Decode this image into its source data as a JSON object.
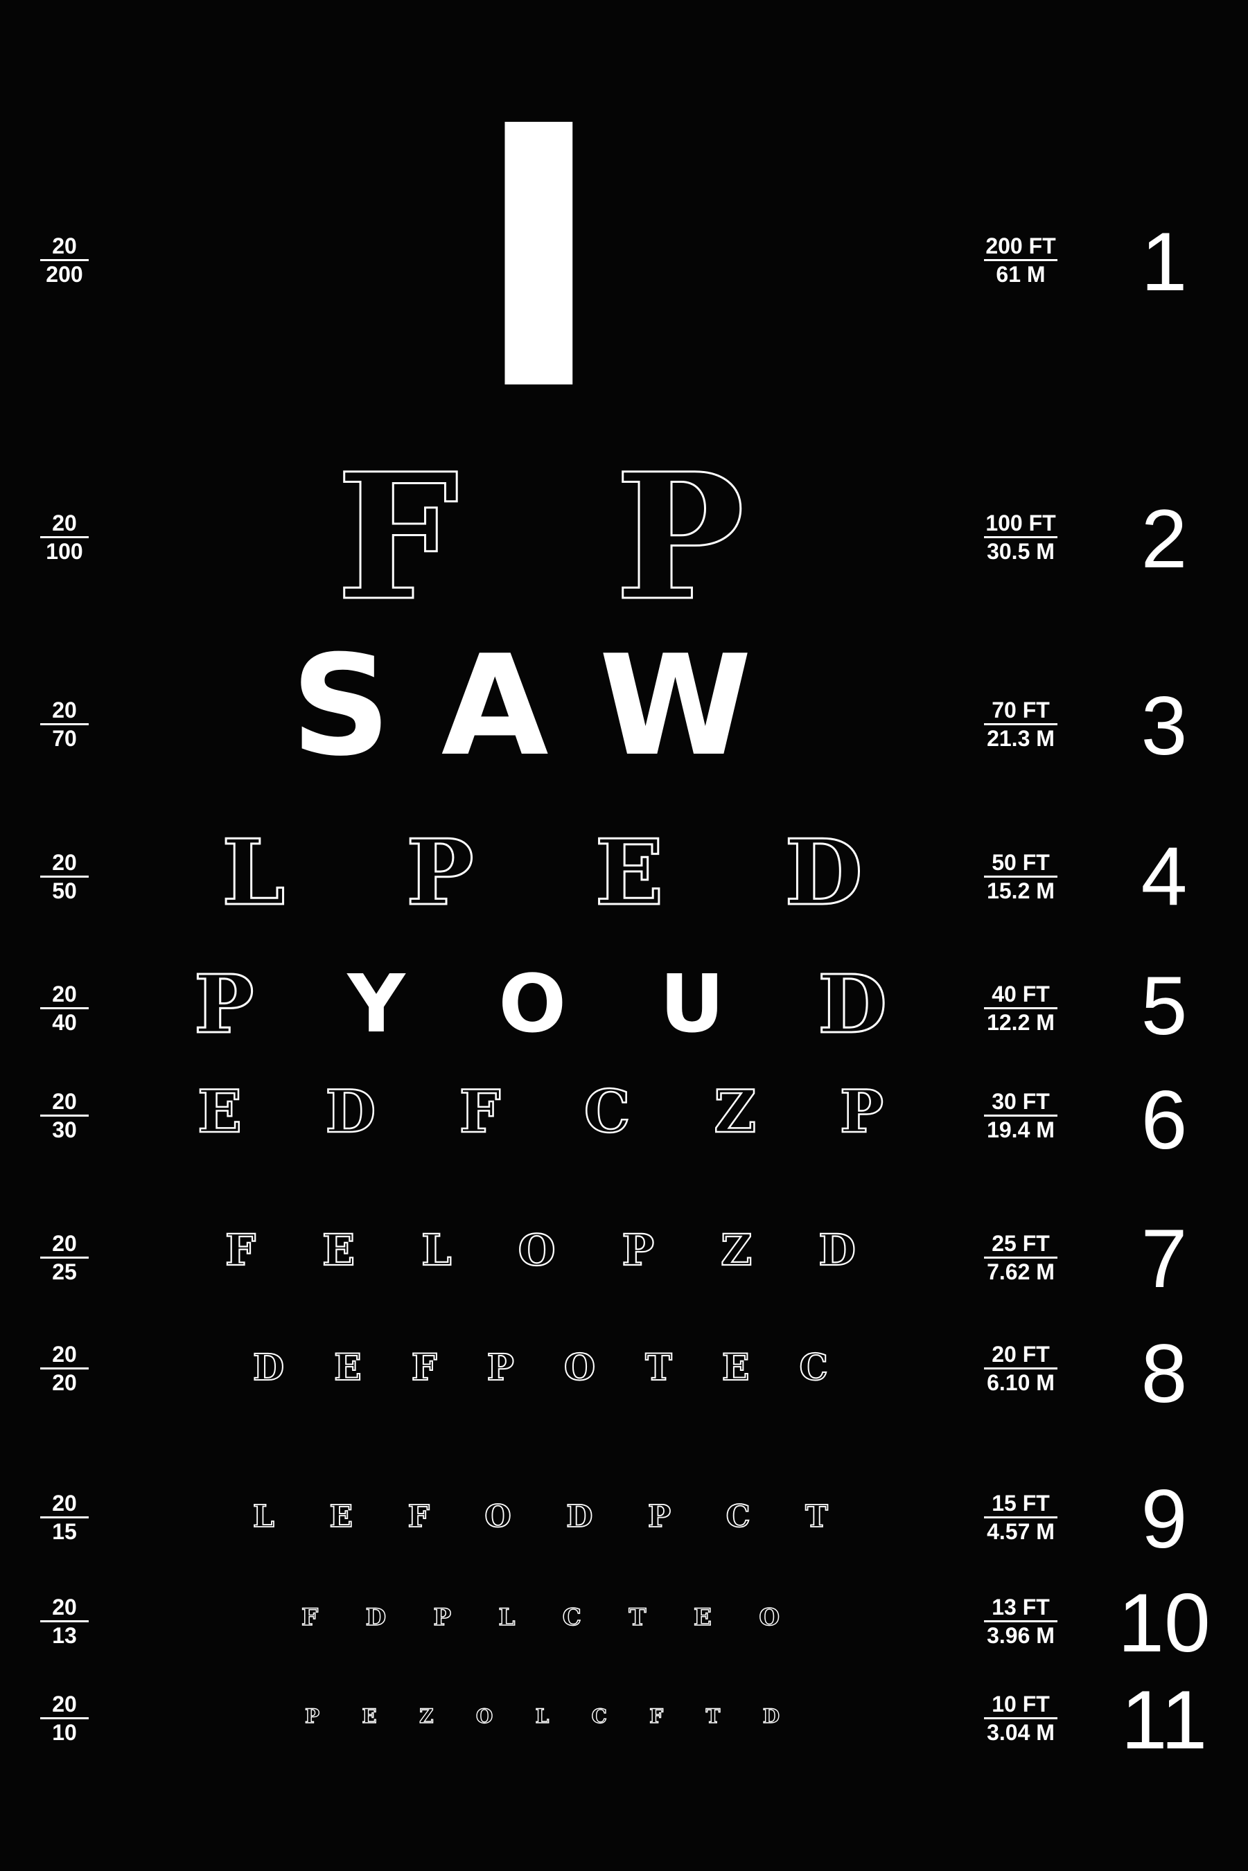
{
  "background_color": "#050505",
  "letter_color": "#ffffff",
  "rows": [
    {
      "acuity_top": "20",
      "acuity_bottom": "200",
      "distance_ft": "200 FT",
      "distance_m": "61 M",
      "line_number": "1",
      "letters": [
        {
          "char": "I",
          "style": "solid"
        }
      ]
    },
    {
      "acuity_top": "20",
      "acuity_bottom": "100",
      "distance_ft": "100 FT",
      "distance_m": "30.5 M",
      "line_number": "2",
      "letters": [
        {
          "char": "F",
          "style": "outline"
        },
        {
          "char": "P",
          "style": "outline"
        }
      ]
    },
    {
      "acuity_top": "20",
      "acuity_bottom": "70",
      "distance_ft": "70 FT",
      "distance_m": "21.3 M",
      "line_number": "3",
      "letters": [
        {
          "char": "S",
          "style": "solid"
        },
        {
          "char": "A",
          "style": "solid"
        },
        {
          "char": "W",
          "style": "solid"
        }
      ]
    },
    {
      "acuity_top": "20",
      "acuity_bottom": "50",
      "distance_ft": "50 FT",
      "distance_m": "15.2 M",
      "line_number": "4",
      "letters": [
        {
          "char": "L",
          "style": "outline"
        },
        {
          "char": "P",
          "style": "outline"
        },
        {
          "char": "E",
          "style": "outline"
        },
        {
          "char": "D",
          "style": "outline"
        }
      ]
    },
    {
      "acuity_top": "20",
      "acuity_bottom": "40",
      "distance_ft": "40 FT",
      "distance_m": "12.2 M",
      "line_number": "5",
      "letters": [
        {
          "char": "P",
          "style": "outline"
        },
        {
          "char": "Y",
          "style": "solid"
        },
        {
          "char": "O",
          "style": "solid"
        },
        {
          "char": "U",
          "style": "solid"
        },
        {
          "char": "D",
          "style": "outline"
        }
      ]
    },
    {
      "acuity_top": "20",
      "acuity_bottom": "30",
      "distance_ft": "30 FT",
      "distance_m": "19.4 M",
      "line_number": "6",
      "letters": [
        {
          "char": "E",
          "style": "outline"
        },
        {
          "char": "D",
          "style": "outline"
        },
        {
          "char": "F",
          "style": "outline"
        },
        {
          "char": "C",
          "style": "outline"
        },
        {
          "char": "Z",
          "style": "outline"
        },
        {
          "char": "P",
          "style": "outline"
        }
      ]
    },
    {
      "acuity_top": "20",
      "acuity_bottom": "25",
      "distance_ft": "25 FT",
      "distance_m": "7.62 M",
      "line_number": "7",
      "letters": [
        {
          "char": "F",
          "style": "outline"
        },
        {
          "char": "E",
          "style": "outline"
        },
        {
          "char": "L",
          "style": "outline"
        },
        {
          "char": "O",
          "style": "outline"
        },
        {
          "char": "P",
          "style": "outline"
        },
        {
          "char": "Z",
          "style": "outline"
        },
        {
          "char": "D",
          "style": "outline"
        }
      ]
    },
    {
      "acuity_top": "20",
      "acuity_bottom": "20",
      "distance_ft": "20 FT",
      "distance_m": "6.10 M",
      "line_number": "8",
      "letters": [
        {
          "char": "D",
          "style": "outline"
        },
        {
          "char": "E",
          "style": "outline"
        },
        {
          "char": "F",
          "style": "outline"
        },
        {
          "char": "P",
          "style": "outline"
        },
        {
          "char": "O",
          "style": "outline"
        },
        {
          "char": "T",
          "style": "outline"
        },
        {
          "char": "E",
          "style": "outline"
        },
        {
          "char": "C",
          "style": "outline"
        }
      ]
    },
    {
      "acuity_top": "20",
      "acuity_bottom": "15",
      "distance_ft": "15 FT",
      "distance_m": "4.57 M",
      "line_number": "9",
      "letters": [
        {
          "char": "L",
          "style": "outline"
        },
        {
          "char": "E",
          "style": "outline"
        },
        {
          "char": "F",
          "style": "outline"
        },
        {
          "char": "O",
          "style": "outline"
        },
        {
          "char": "D",
          "style": "outline"
        },
        {
          "char": "P",
          "style": "outline"
        },
        {
          "char": "C",
          "style": "outline"
        },
        {
          "char": "T",
          "style": "outline"
        }
      ]
    },
    {
      "acuity_top": "20",
      "acuity_bottom": "13",
      "distance_ft": "13 FT",
      "distance_m": "3.96 M",
      "line_number": "10",
      "letters": [
        {
          "char": "F",
          "style": "outline"
        },
        {
          "char": "D",
          "style": "outline"
        },
        {
          "char": "P",
          "style": "outline"
        },
        {
          "char": "L",
          "style": "outline"
        },
        {
          "char": "C",
          "style": "outline"
        },
        {
          "char": "T",
          "style": "outline"
        },
        {
          "char": "E",
          "style": "outline"
        },
        {
          "char": "O",
          "style": "outline"
        }
      ]
    },
    {
      "acuity_top": "20",
      "acuity_bottom": "10",
      "distance_ft": "10 FT",
      "distance_m": "3.04 M",
      "line_number": "11",
      "letters": [
        {
          "char": "P",
          "style": "outline"
        },
        {
          "char": "E",
          "style": "outline"
        },
        {
          "char": "Z",
          "style": "outline"
        },
        {
          "char": "O",
          "style": "outline"
        },
        {
          "char": "L",
          "style": "outline"
        },
        {
          "char": "C",
          "style": "outline"
        },
        {
          "char": "F",
          "style": "outline"
        },
        {
          "char": "T",
          "style": "outline"
        },
        {
          "char": "D",
          "style": "outline"
        }
      ]
    }
  ]
}
